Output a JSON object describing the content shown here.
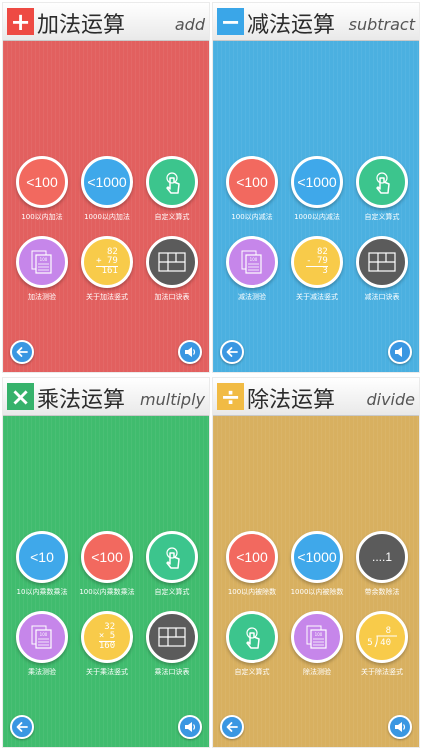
{
  "colors": {
    "add_bg": "#e2605f",
    "subtract_bg": "#4bb0e0",
    "multiply_bg": "#40bc6e",
    "divide_bg": "#d8b060",
    "add_box": "#ee4a43",
    "subtract_box": "#3aa6e8",
    "multiply_box": "#36b26b",
    "divide_box": "#f1bb44"
  },
  "panels": {
    "add": {
      "symbol": "+",
      "title": "加法运算",
      "subtitle": "add",
      "buttons": [
        {
          "text": "<100",
          "label": "100以内加法"
        },
        {
          "text": "<1000",
          "label": "1000以内加法"
        },
        {
          "text": "",
          "label": "自定义算式"
        },
        {
          "text": "100",
          "label": "加法测验"
        },
        {
          "text": "",
          "label": "关于加法竖式",
          "lines": [
            "82",
            "+ 79",
            "161"
          ]
        },
        {
          "text": "",
          "label": "加法口诀表"
        }
      ]
    },
    "subtract": {
      "symbol": "−",
      "title": "减法运算",
      "subtitle": "subtract",
      "buttons": [
        {
          "text": "<100",
          "label": "100以内减法"
        },
        {
          "text": "<1000",
          "label": "1000以内减法"
        },
        {
          "text": "",
          "label": "自定义算式"
        },
        {
          "text": "100",
          "label": "减法测验"
        },
        {
          "text": "",
          "label": "关于减法竖式",
          "lines": [
            "82",
            "- 79",
            "3"
          ]
        },
        {
          "text": "",
          "label": "减法口诀表"
        }
      ]
    },
    "multiply": {
      "symbol": "×",
      "title": "乘法运算",
      "subtitle": "multiply",
      "buttons": [
        {
          "text": "<10",
          "label": "10以内乘数乘法"
        },
        {
          "text": "<100",
          "label": "100以内乘数乘法"
        },
        {
          "text": "",
          "label": "自定义算式"
        },
        {
          "text": "100",
          "label": "乘法测验"
        },
        {
          "text": "",
          "label": "关于乘法竖式",
          "lines": [
            "32",
            "× 5",
            "160"
          ]
        },
        {
          "text": "",
          "label": "乘法口诀表"
        }
      ]
    },
    "divide": {
      "symbol": "÷",
      "title": "除法运算",
      "subtitle": "divide",
      "buttons": [
        {
          "text": "<100",
          "label": "100以内被除数"
        },
        {
          "text": "<1000",
          "label": "1000以内被除数"
        },
        {
          "text": "....1",
          "label": "带余数除法"
        },
        {
          "text": "",
          "label": "自定义算式"
        },
        {
          "text": "100",
          "label": "除法测验"
        },
        {
          "text": "",
          "label": "关于除法竖式",
          "lines": [
            "8",
            "5",
            "40"
          ]
        }
      ]
    }
  },
  "icons": {
    "back": "back-arrow-icon",
    "sound": "speaker-icon"
  }
}
